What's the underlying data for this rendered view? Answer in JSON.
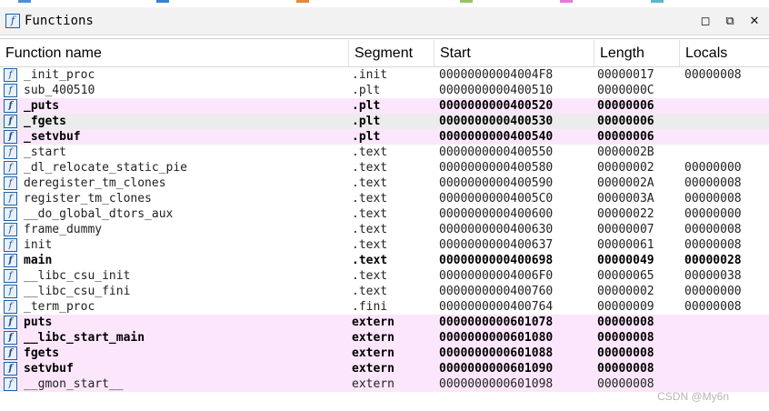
{
  "window": {
    "title": "Functions",
    "icon": "function-icon",
    "controls": [
      "maximize-icon",
      "float-icon",
      "close-icon"
    ]
  },
  "columns": {
    "name": "Function name",
    "segment": "Segment",
    "start": "Start",
    "length": "Length",
    "locals": "Locals"
  },
  "rows": [
    {
      "name": "_init_proc",
      "segment": ".init",
      "start": "00000000004004F8",
      "length": "00000017",
      "locals": "00000008",
      "style": "normal"
    },
    {
      "name": "sub_400510",
      "segment": ".plt",
      "start": "0000000000400510",
      "length": "0000000C",
      "locals": "",
      "style": "normal"
    },
    {
      "name": "_puts",
      "segment": ".plt",
      "start": "0000000000400520",
      "length": "00000006",
      "locals": "",
      "style": "bold-hl"
    },
    {
      "name": "_fgets",
      "segment": ".plt",
      "start": "0000000000400530",
      "length": "00000006",
      "locals": "",
      "style": "bold-sel"
    },
    {
      "name": "_setvbuf",
      "segment": ".plt",
      "start": "0000000000400540",
      "length": "00000006",
      "locals": "",
      "style": "bold-hl"
    },
    {
      "name": "_start",
      "segment": ".text",
      "start": "0000000000400550",
      "length": "0000002B",
      "locals": "",
      "style": "normal"
    },
    {
      "name": "_dl_relocate_static_pie",
      "segment": ".text",
      "start": "0000000000400580",
      "length": "00000002",
      "locals": "00000000",
      "style": "normal"
    },
    {
      "name": "deregister_tm_clones",
      "segment": ".text",
      "start": "0000000000400590",
      "length": "0000002A",
      "locals": "00000008",
      "style": "normal"
    },
    {
      "name": "register_tm_clones",
      "segment": ".text",
      "start": "00000000004005C0",
      "length": "0000003A",
      "locals": "00000008",
      "style": "normal"
    },
    {
      "name": "__do_global_dtors_aux",
      "segment": ".text",
      "start": "0000000000400600",
      "length": "00000022",
      "locals": "00000000",
      "style": "normal"
    },
    {
      "name": "frame_dummy",
      "segment": ".text",
      "start": "0000000000400630",
      "length": "00000007",
      "locals": "00000008",
      "style": "normal"
    },
    {
      "name": "init",
      "segment": ".text",
      "start": "0000000000400637",
      "length": "00000061",
      "locals": "00000008",
      "style": "normal"
    },
    {
      "name": "main",
      "segment": ".text",
      "start": "0000000000400698",
      "length": "00000049",
      "locals": "00000028",
      "style": "bold"
    },
    {
      "name": "__libc_csu_init",
      "segment": ".text",
      "start": "00000000004006F0",
      "length": "00000065",
      "locals": "00000038",
      "style": "normal"
    },
    {
      "name": "__libc_csu_fini",
      "segment": ".text",
      "start": "0000000000400760",
      "length": "00000002",
      "locals": "00000000",
      "style": "normal"
    },
    {
      "name": "_term_proc",
      "segment": ".fini",
      "start": "0000000000400764",
      "length": "00000009",
      "locals": "00000008",
      "style": "normal"
    },
    {
      "name": "puts",
      "segment": "extern",
      "start": "0000000000601078",
      "length": "00000008",
      "locals": "",
      "style": "bold-hl"
    },
    {
      "name": "__libc_start_main",
      "segment": "extern",
      "start": "0000000000601080",
      "length": "00000008",
      "locals": "",
      "style": "bold-hl"
    },
    {
      "name": "fgets",
      "segment": "extern",
      "start": "0000000000601088",
      "length": "00000008",
      "locals": "",
      "style": "bold-hl"
    },
    {
      "name": "setvbuf",
      "segment": "extern",
      "start": "0000000000601090",
      "length": "00000008",
      "locals": "",
      "style": "bold-hl"
    },
    {
      "name": "__gmon_start__",
      "segment": "extern",
      "start": "0000000000601098",
      "length": "00000008",
      "locals": "",
      "style": "hl"
    }
  ],
  "watermark": "CSDN @My6n",
  "colors": {
    "highlight": "#fbe6fb",
    "selected": "#ececec",
    "icon_border": "#1d5fa8"
  }
}
